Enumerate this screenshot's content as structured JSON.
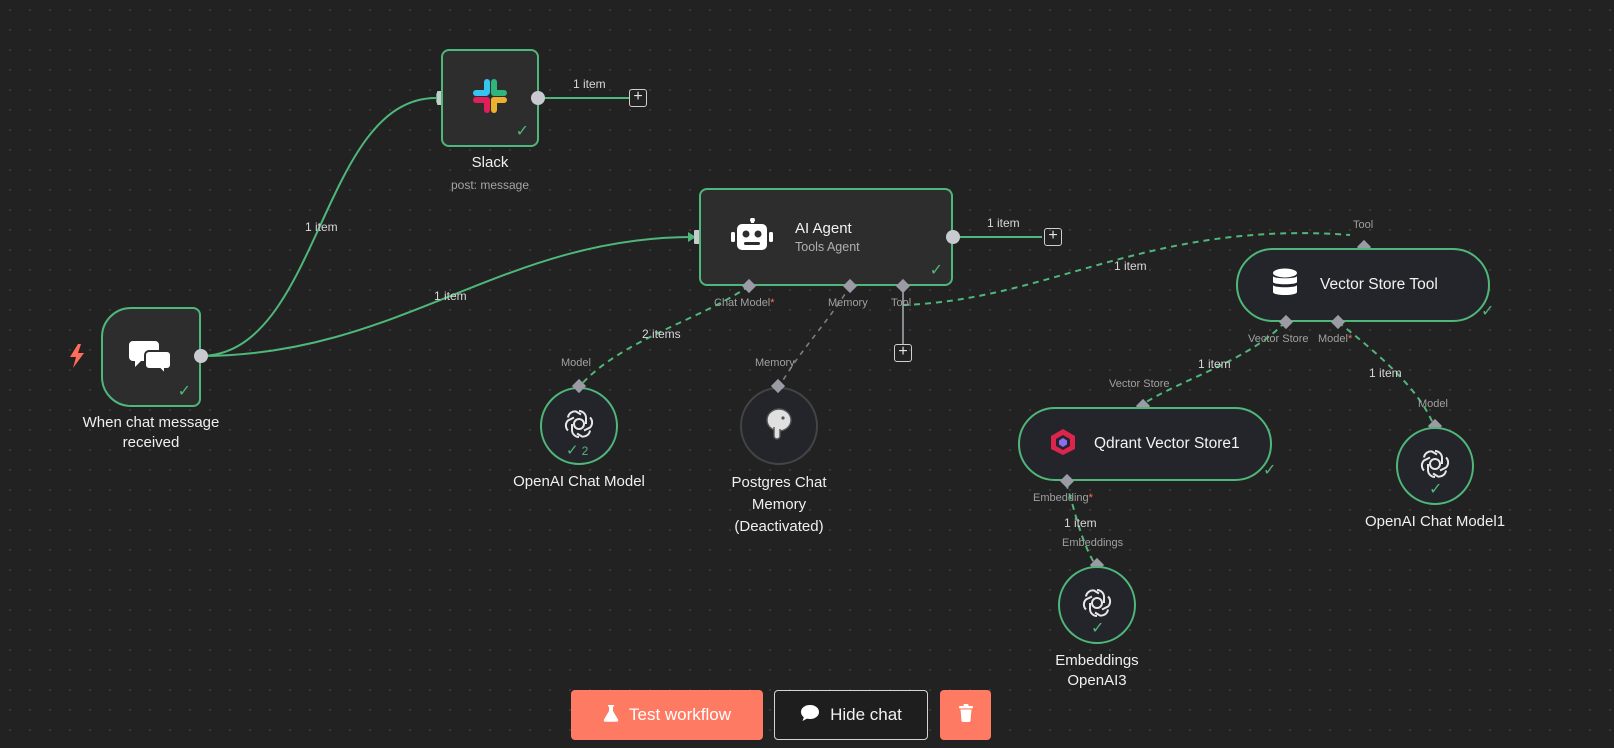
{
  "nodes": {
    "trigger": {
      "title_line1": "When chat message",
      "title_line2": "received"
    },
    "slack": {
      "title": "Slack",
      "subtitle": "post: message"
    },
    "agent": {
      "title": "AI Agent",
      "subtitle": "Tools Agent",
      "ports": {
        "chat_model": "Chat Model",
        "memory": "Memory",
        "tool": "Tool"
      }
    },
    "openai_chat": {
      "title": "OpenAI Chat Model",
      "port": "Model",
      "run_count": "2"
    },
    "postgres": {
      "title_line1": "Postgres Chat",
      "title_line2": "Memory",
      "title_line3": "(Deactivated)",
      "port": "Memory"
    },
    "vector_tool": {
      "title": "Vector Store Tool",
      "port_top": "Tool",
      "port_vs": "Vector Store",
      "port_model": "Model"
    },
    "qdrant": {
      "title": "Qdrant Vector Store1",
      "port_top": "Vector Store",
      "port_bottom": "Embedding"
    },
    "openai_chat1": {
      "title": "OpenAI Chat Model1",
      "port": "Model"
    },
    "embeddings": {
      "title_line1": "Embeddings",
      "title_line2": "OpenAI3",
      "port": "Embeddings"
    }
  },
  "edge_labels": {
    "trigger_slack": "1 item",
    "trigger_agent": "1 item",
    "slack_out": "1 item",
    "agent_out": "1 item",
    "agent_model": "2 items",
    "agent_tool": "1 item",
    "tool_vs": "1 item",
    "tool_model": "1 item",
    "qdrant_emb": "1 item"
  },
  "required_marker": "*",
  "toolbar": {
    "test_label": "Test workflow",
    "hide_chat_label": "Hide chat"
  },
  "icons": [
    "lightning-icon",
    "chat-bubbles-icon",
    "slack-icon",
    "robot-icon",
    "openai-icon",
    "postgres-icon",
    "database-icon",
    "qdrant-icon",
    "flask-icon",
    "speech-bubble-icon",
    "trash-icon",
    "check-icon",
    "plus-icon"
  ],
  "colors": {
    "success": "#4fb77a",
    "accent": "#ff7a62",
    "canvas": "#222222",
    "trigger": "#ff6d5a"
  }
}
